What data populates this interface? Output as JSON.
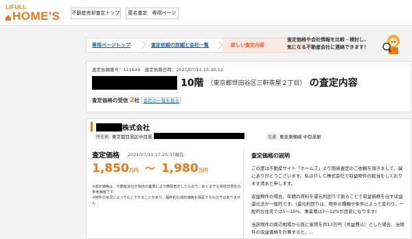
{
  "header": {
    "logo_small": "LIFULL",
    "logo_big": "HOME'S",
    "nav": [
      "不動産売却査定トップ",
      "匿名査定　専用ページ"
    ]
  },
  "steps": [
    "専用ページトップ",
    "査定依頼の詳細と会社一覧",
    "詳しい査定内容"
  ],
  "promo": [
    "査定価格や会社情報を比較・検討し、",
    "気になる不動産会社に連絡できます！"
  ],
  "summary": {
    "request_no": "査定依頼番号：111649　査定依頼日時：2021/07/11 15:30:12",
    "title_floor": "10階",
    "title_addr": "（東京都世田谷区三軒茶屋２丁目）",
    "title_suffix": "の査定内容",
    "received_label": "査定価格の受信",
    "received_count": "2",
    "received_unit": "社",
    "company_list_link": "会社の一覧を見る"
  },
  "company": {
    "name_suffix": "株式会社",
    "address_tag": "所在地",
    "address": "東京都目黒区中目黒",
    "station_tag": "交通",
    "station": "東急東横線 中目黒駅"
  },
  "price": {
    "heading": "査定価格",
    "time": "2021/07/11 17:20:37現在",
    "low": "1,850",
    "high": "1,980",
    "unit": "万円",
    "tilde": "〜",
    "note1": "※査定価格は、不動産会社が独自の基準により簡易査定したもので、あくまでも受信日現在の参考価格です",
    "note2": "※物件の状況によっても上下することがあり、最終的な成約価格を保証するものではありません"
  },
  "explanation": {
    "heading": "査定価格の説明",
    "p1": "この度は不動産サイト「ホームズ」より簡易査定のご依頼を頂きまして、誠にありがとうございます。私はＯＬＣ株式会社で収益物件の担当をしております清水と申します。",
    "p2": "収益物件の場合、年間の賃料を還元利回りで割ることで収益価格を出す収益還元法が一般的です。(還元利回りは、物件の種類や条件によって変わり、一般的な住宅では5〜10%、事業用は7〜12%が目安になります)",
    "p3": "当該物件の周辺相場から仮に家賃を月13万円（共益費込）とした場合、当物件の収益価格を計算すると、…"
  },
  "colors": {
    "accent": "#e8781a",
    "link": "#1a5fb4",
    "active_step_bg": "#fde9e1"
  }
}
